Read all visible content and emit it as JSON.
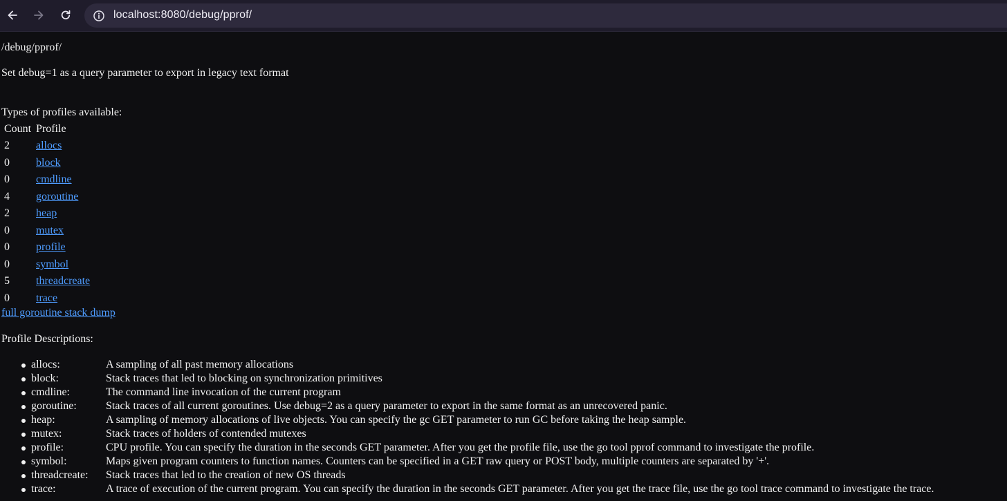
{
  "browser": {
    "url": "localhost:8080/debug/pprof/",
    "back_icon": "arrow-left-icon",
    "forward_icon": "arrow-right-icon",
    "reload_icon": "reload-icon",
    "site_info_icon": "info-circle-icon"
  },
  "page": {
    "path_heading": "/debug/pprof/",
    "legacy_note": "Set debug=1 as a query parameter to export in legacy text format",
    "types_label": "Types of profiles available:",
    "table": {
      "headers": [
        "Count",
        "Profile"
      ],
      "rows": [
        {
          "count": "2",
          "profile": "allocs"
        },
        {
          "count": "0",
          "profile": "block"
        },
        {
          "count": "0",
          "profile": "cmdline"
        },
        {
          "count": "4",
          "profile": "goroutine"
        },
        {
          "count": "2",
          "profile": "heap"
        },
        {
          "count": "0",
          "profile": "mutex"
        },
        {
          "count": "0",
          "profile": "profile"
        },
        {
          "count": "0",
          "profile": "symbol"
        },
        {
          "count": "5",
          "profile": "threadcreate"
        },
        {
          "count": "0",
          "profile": "trace"
        }
      ]
    },
    "full_dump_link": "full goroutine stack dump",
    "descriptions_label": "Profile Descriptions:",
    "descriptions": [
      {
        "name": "allocs:",
        "text": "A sampling of all past memory allocations"
      },
      {
        "name": "block:",
        "text": "Stack traces that led to blocking on synchronization primitives"
      },
      {
        "name": "cmdline:",
        "text": "The command line invocation of the current program"
      },
      {
        "name": "goroutine:",
        "text": "Stack traces of all current goroutines. Use debug=2 as a query parameter to export in the same format as an unrecovered panic."
      },
      {
        "name": "heap:",
        "text": "A sampling of memory allocations of live objects. You can specify the gc GET parameter to run GC before taking the heap sample."
      },
      {
        "name": "mutex:",
        "text": "Stack traces of holders of contended mutexes"
      },
      {
        "name": "profile:",
        "text": "CPU profile. You can specify the duration in the seconds GET parameter. After you get the profile file, use the go tool pprof command to investigate the profile."
      },
      {
        "name": "symbol:",
        "text": "Maps given program counters to function names. Counters can be specified in a GET raw query or POST body, multiple counters are separated by '+'."
      },
      {
        "name": "threadcreate:",
        "text": "Stack traces that led to the creation of new OS threads"
      },
      {
        "name": "trace:",
        "text": "A trace of execution of the current program. You can specify the duration in the seconds GET parameter. After you get the trace file, use the go tool trace command to investigate the trace."
      }
    ]
  },
  "colors": {
    "background": "#0e0e11",
    "text": "#f1f1f1",
    "link": "#4e9cff",
    "toolbar": "#1f1c2b",
    "omnibox": "#2e2a3d"
  }
}
